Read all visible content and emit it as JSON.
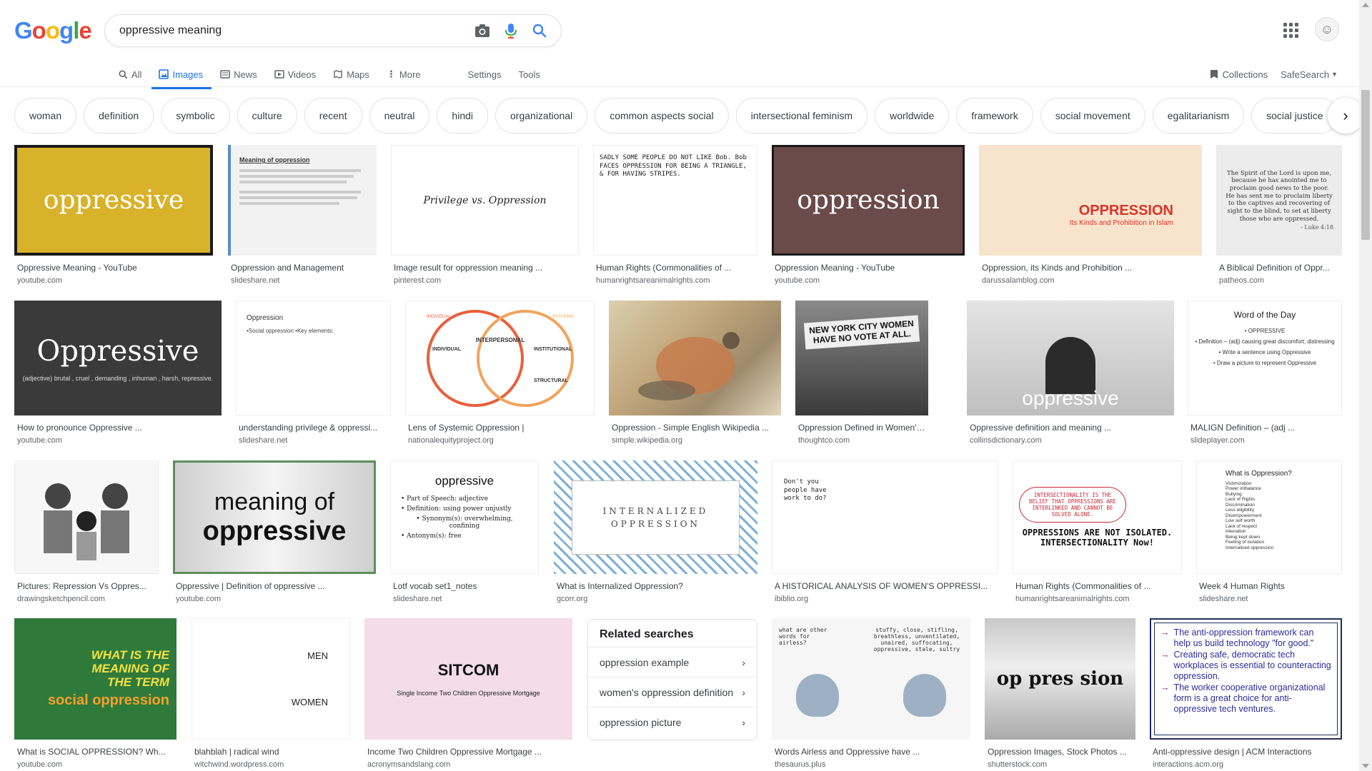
{
  "logo": {
    "letters": [
      "G",
      "o",
      "o",
      "g",
      "l",
      "e"
    ],
    "colors": [
      "#4285f4",
      "#ea4335",
      "#fbbc05",
      "#4285f4",
      "#34a853",
      "#ea4335"
    ]
  },
  "search": {
    "query": "oppressive meaning"
  },
  "nav": {
    "tabs": [
      {
        "label": "All",
        "icon": "search-icon"
      },
      {
        "label": "Images",
        "icon": "image-icon",
        "active": true
      },
      {
        "label": "News",
        "icon": "news-icon"
      },
      {
        "label": "Videos",
        "icon": "video-icon"
      },
      {
        "label": "Maps",
        "icon": "map-icon"
      },
      {
        "label": "More",
        "icon": "more-vert-icon"
      }
    ],
    "settings": "Settings",
    "tools": "Tools",
    "collections": "Collections",
    "safesearch": "SafeSearch"
  },
  "chips": [
    "woman",
    "definition",
    "symbolic",
    "culture",
    "recent",
    "neutral",
    "hindi",
    "organizational",
    "common aspects social",
    "intersectional feminism",
    "worldwide",
    "framework",
    "social movement",
    "egalitarianism",
    "social justice"
  ],
  "results": [
    {
      "caption": "Oppressive Meaning - YouTube",
      "source": "youtube.com",
      "thumb_text": "oppressive"
    },
    {
      "caption": "Oppression and Management",
      "source": "slideshare.net",
      "thumb_text": "Meaning of oppression"
    },
    {
      "caption": "Image result for oppression meaning ...",
      "source": "pinterest.com",
      "thumb_text": "Privilege vs. Oppression"
    },
    {
      "caption": "Human Rights (Commonalities of ...",
      "source": "humanrightsareanimalrights.com",
      "thumb_text": "SADLY SOME PEOPLE DO NOT LIKE Bob. Bob FACES OPPRESSION FOR BEING A TRIANGLE, & FOR HAVING STRIPES."
    },
    {
      "caption": "Oppression Meaning - YouTube",
      "source": "youtube.com",
      "thumb_text": "oppression"
    },
    {
      "caption": "Oppression, its Kinds and Prohibition ...",
      "source": "darussalamblog.com",
      "thumb_text": "OPPRESSION",
      "thumb_sub": "Its Kinds and Prohibition in Islam"
    },
    {
      "caption": "A Biblical Definition of Oppr...",
      "source": "patheos.com",
      "thumb_text": "The Spirit of the Lord is upon me, because he has anointed me to proclaim good news to the poor. He has sent me to proclaim liberty to the captives and recovering of sight to the blind, to set at liberty those who are oppressed.",
      "thumb_sub": "- Luke 4:18"
    },
    {
      "caption": "How to pronounce Oppressive ...",
      "source": "youtube.com",
      "thumb_text": "Oppressive",
      "thumb_sub": "(adjective) brutal , cruel , demanding , inhuman , harsh, repressive."
    },
    {
      "caption": "understanding privilege & oppressi...",
      "source": "slideshare.net",
      "thumb_text": "Oppression",
      "thumb_sub": "•Social oppression •Key elements:"
    },
    {
      "caption": "Lens of Systemic Oppression |",
      "source": "nationalequityproject.org",
      "thumb_text": "INTERPERSONAL",
      "labels": [
        "INDIVIDUAL",
        "SYSTEMIC",
        "INDIVIDUAL",
        "INSTITUTIONAL",
        "STRUCTURAL"
      ]
    },
    {
      "caption": "Oppression - Simple English Wikipedia ...",
      "source": "simple.wikipedia.org",
      "thumb_text": ""
    },
    {
      "caption": "Oppression Defined in Women's His...",
      "source": "thoughtco.com",
      "thumb_text": "NEW YORK CITY WOMEN HAVE NO VOTE AT ALL."
    },
    {
      "caption": "Oppressive definition and meaning ...",
      "source": "collinsdictionary.com",
      "thumb_text": "oppressive"
    },
    {
      "caption": "MALIGN Definition – (adj ...",
      "source": "slideplayer.com",
      "thumb_text": "Word of the Day",
      "thumb_lines": [
        "• OPPRESSIVE",
        "• Definition – (adj) causing great discomfort; distressing",
        "• Write a sentence using Oppressive",
        "• Draw a picture to represent Oppressive"
      ]
    },
    {
      "caption": "Pictures: Repression Vs Oppres...",
      "source": "drawingsketchpencil.com",
      "thumb_text": ""
    },
    {
      "caption": "Oppressive | Definition of oppressive ...",
      "source": "youtube.com",
      "thumb_text": "meaning of",
      "thumb_sub": "oppressive"
    },
    {
      "caption": "Lotf vocab set1_notes",
      "source": "slideshare.net",
      "thumb_text": "oppressive",
      "thumb_lines": [
        "• Part of Speech: adjective",
        "• Definition: using power unjustly",
        "• Synonym(s): overwhelming, confining",
        "• Antonym(s): free"
      ]
    },
    {
      "caption": "What is Internalized Oppression?",
      "source": "gcorr.org",
      "thumb_text": "INTERNALIZED",
      "thumb_sub": "OPPRESSION"
    },
    {
      "caption": "A HISTORICAL ANALYSIS OF WOMEN'S OPPRESSI...",
      "source": "ibiblio.org",
      "thumb_text": "Don't you people have work to do?"
    },
    {
      "caption": "Human Rights (Commonalities of ...",
      "source": "humanrightsareanimalrights.com",
      "thumb_text": "INTERSECTIONALITY IS THE BELIEF THAT OPPRESSIONS ARE INTERLINKED AND CANNOT BE SOLVED ALONE.",
      "thumb_sub": "OPPRESSIONS ARE NOT ISOLATED. INTERSECTIONALITY Now!"
    },
    {
      "caption": "Week 4 Human Rights",
      "source": "slideshare.net",
      "thumb_text": "What is Oppression?",
      "thumb_lines": [
        "Victimization",
        "Power imbalance",
        "Bullying",
        "Lack of Rights",
        "Discrimination",
        "Less eligibility",
        "Disempowerment",
        "Low self worth",
        "Lack of respect",
        "Alienation",
        "Being kept down",
        "Feeling of isolation",
        "Internalised oppression"
      ]
    },
    {
      "caption": "What is SOCIAL OPPRESSION? Wh...",
      "source": "youtube.com",
      "thumb_text": "WHAT IS THE MEANING OF THE TERM",
      "thumb_sub": "social oppression"
    },
    {
      "caption": "blahblah | radical wind",
      "source": "witchwind.wordpress.com",
      "thumb_text": "MEN",
      "thumb_sub": "WOMEN"
    },
    {
      "caption": "Income Two Children Oppressive Mortgage ...",
      "source": "acronymsandslang.com",
      "thumb_text": "SITCOM",
      "thumb_sub": "Single Income Two Children Oppressive Mortgage"
    },
    {
      "caption": "Words Airless and Oppressive have ...",
      "source": "thesaurus.plus",
      "thumb_text": "what are other words for airless?",
      "thumb_sub": "stuffy, close, stifling, breathless, unventilated, unaired, suffocating, oppressive, stale, sultry"
    },
    {
      "caption": "Oppression Images, Stock Photos ...",
      "source": "shutterstock.com",
      "thumb_text": "op pres sion"
    },
    {
      "caption": "Anti-oppressive design | ACM Interactions",
      "source": "interactions.acm.org",
      "thumb_lines": [
        "The anti-oppression framework can help us build technology \"for good.\"",
        "Creating safe, democratic tech workplaces is essential to counteracting oppression.",
        "The worker cooperative organizational form is a great choice for anti-oppressive tech ventures."
      ]
    }
  ],
  "related": {
    "title": "Related searches",
    "items": [
      "oppression example",
      "women's oppression definition",
      "oppression picture"
    ]
  }
}
